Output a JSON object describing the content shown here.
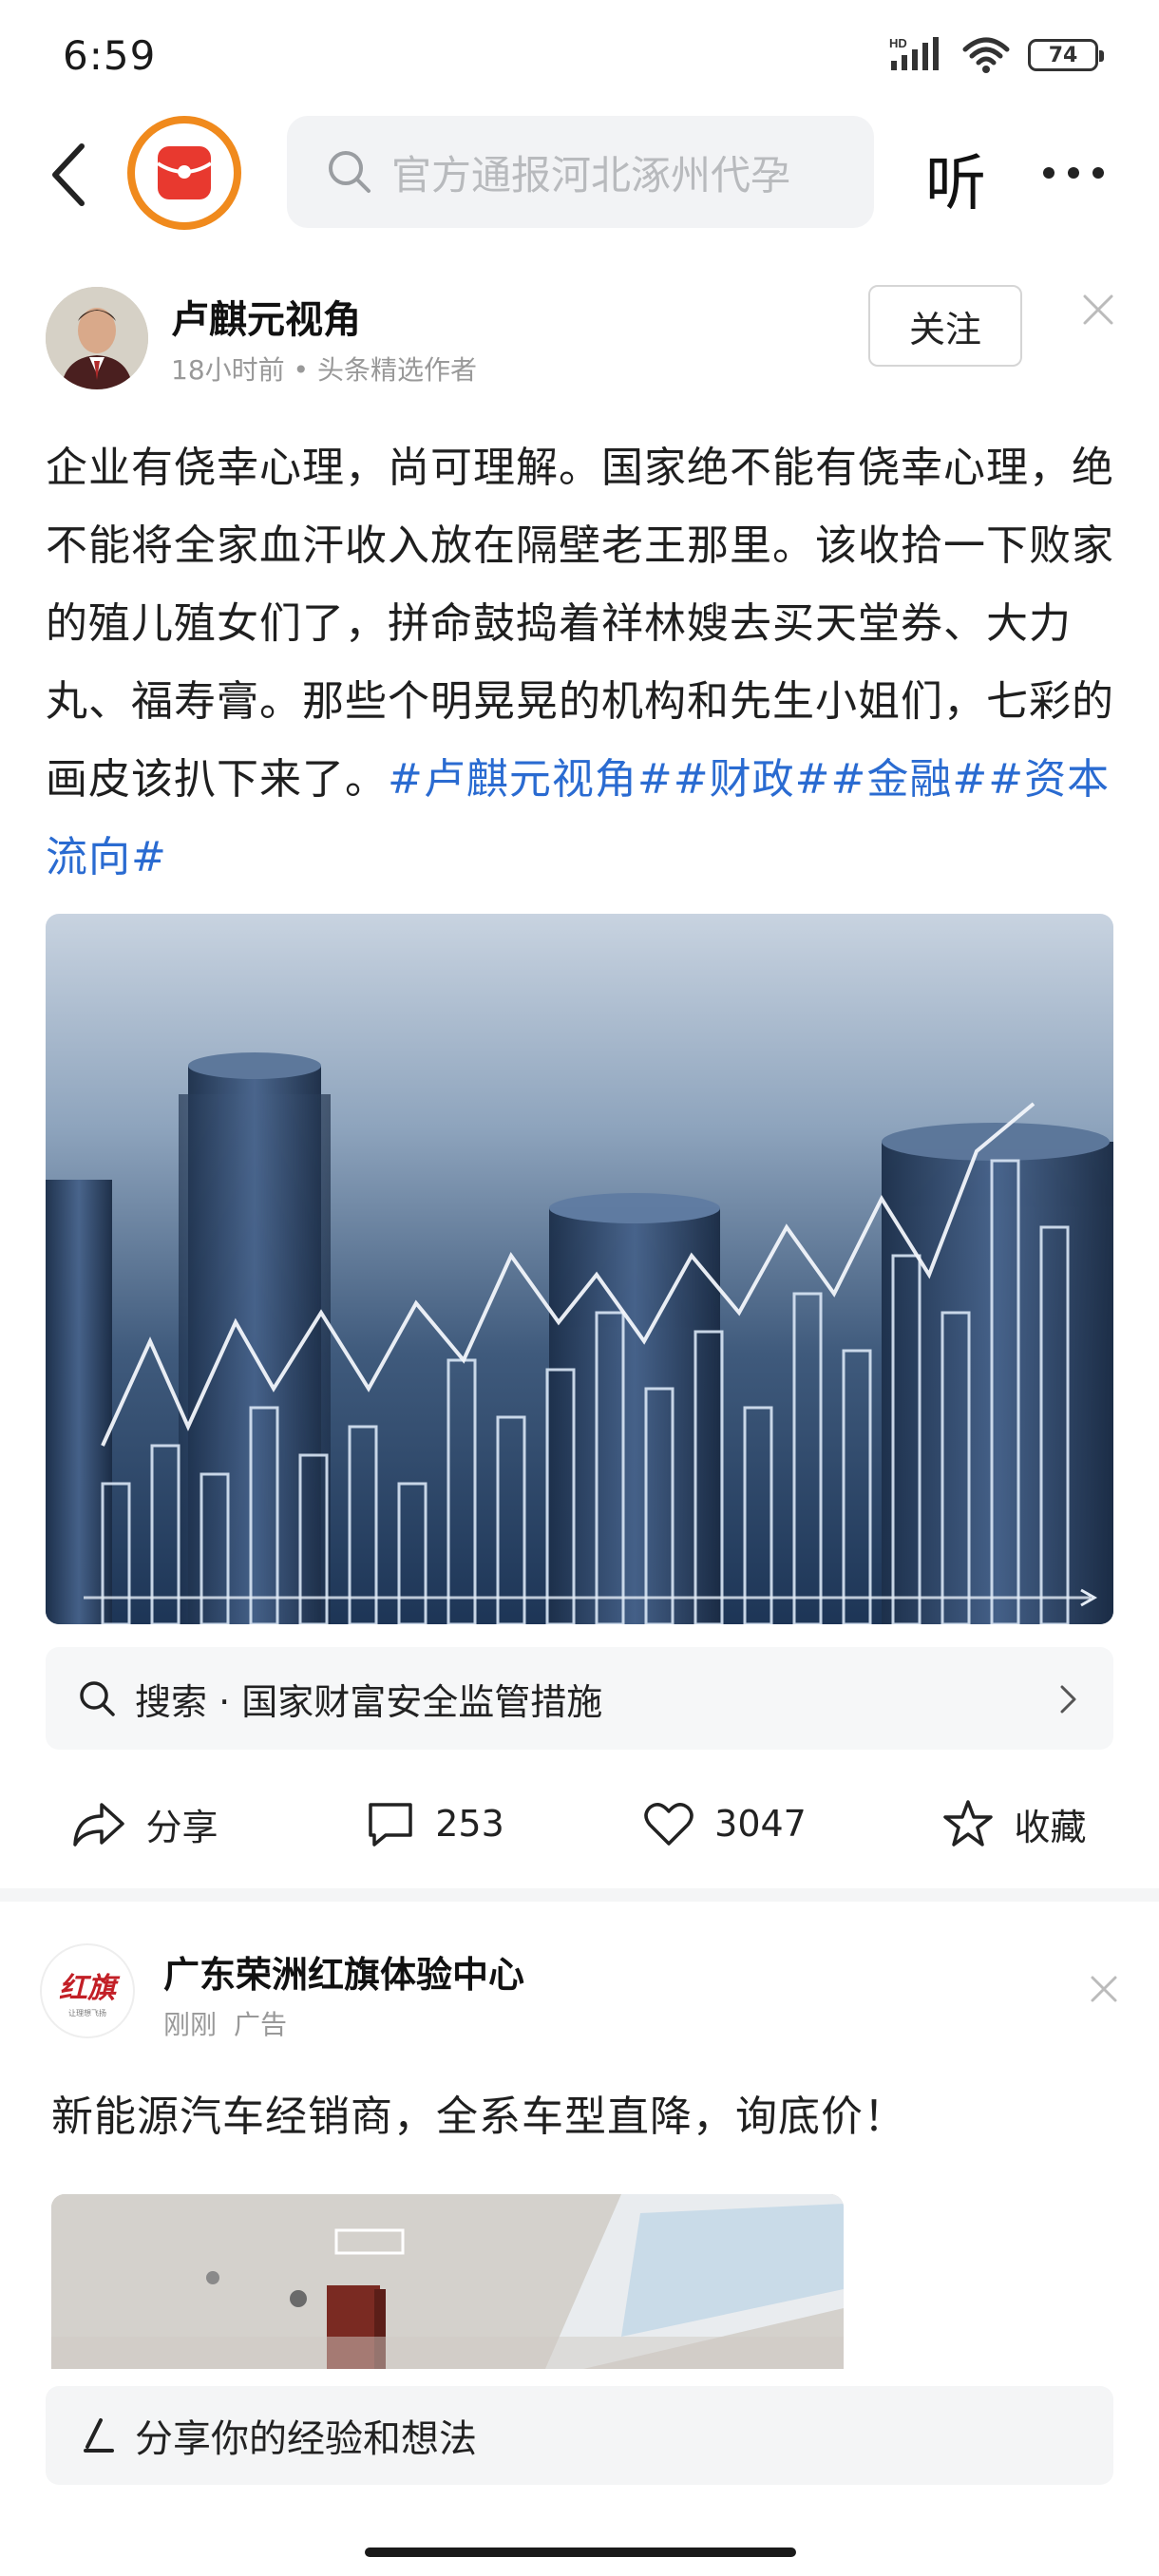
{
  "status_bar": {
    "time": "6:59",
    "network": "HD",
    "battery": "74"
  },
  "top_nav": {
    "search_placeholder": "官方通报河北涿州代孕",
    "listen_label": "听"
  },
  "post": {
    "author_name": "卢麒元视角",
    "time_ago": "18小时前",
    "author_badge": "头条精选作者",
    "follow_label": "关注",
    "body_text": "企业有侥幸心理，尚可理解。国家绝不能有侥幸心理，绝不能将全家血汗收入放在隔壁老王那里。该收拾一下败家的殖儿殖女们了，拼命鼓捣着祥林嫂去买天堂券、大力丸、福寿膏。那些个明晃晃的机构和先生小姐们，七彩的画皮该扒下来了。",
    "hashtags": [
      "#卢麒元视角#",
      "#财政#",
      "#金融#",
      "#资本流向#"
    ],
    "search_suggestion": "搜索 · 国家财富安全监管措施",
    "actions": {
      "share": "分享",
      "comments": "253",
      "likes": "3047",
      "favorite": "收藏"
    }
  },
  "ad": {
    "logo_text": "红旗",
    "logo_sub": "让理想飞扬",
    "name": "广东荣洲红旗体验中心",
    "time": "刚刚",
    "tag": "广告",
    "text": "新能源汽车经销商，全系车型直降，询底价！"
  },
  "comment_bar": {
    "placeholder": "分享你的经验和想法"
  },
  "colors": {
    "hashtag": "#2a6bd1",
    "brand_orange": "#f08a1d",
    "brand_red": "#e8392f"
  }
}
